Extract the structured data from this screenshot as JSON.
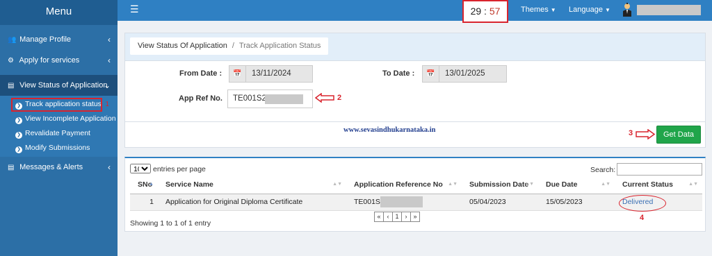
{
  "sidebar": {
    "title": "Menu",
    "items": [
      {
        "label": "Manage Profile"
      },
      {
        "label": "Apply for services"
      },
      {
        "label": "View Status of Application"
      },
      {
        "label": "Messages & Alerts"
      }
    ],
    "submenu": [
      {
        "label": "Track application status"
      },
      {
        "label": "View Incomplete Application"
      },
      {
        "label": "Revalidate Payment"
      },
      {
        "label": "Modify Submissions"
      }
    ],
    "annotation": "1"
  },
  "topbar": {
    "timer_min": "29",
    "timer_sep": ":",
    "timer_sec": "57",
    "themes": "Themes",
    "language": "Language"
  },
  "breadcrumb": {
    "root": "View Status Of Application",
    "separator": "/",
    "current": "Track Application Status"
  },
  "form": {
    "from_label": "From Date :",
    "from_value": "13/11/2024",
    "to_label": "To Date :",
    "to_value": "13/01/2025",
    "ref_label": "App Ref No.",
    "ref_value": "TE001S2",
    "ref_annotation": "2",
    "site": "www.sevasindhukarnataka.in",
    "get_button": "Get Data",
    "get_annotation": "3"
  },
  "table": {
    "length_value": "10",
    "length_label": "entries per page",
    "search_label": "Search:",
    "headers": [
      "SNo",
      "Service Name",
      "Application Reference No",
      "Submission Date",
      "Due Date",
      "Current Status"
    ],
    "rows": [
      {
        "sno": "1",
        "service": "Application for Original Diploma Certificate",
        "ref": "TE001S",
        "submission": "05/04/2023",
        "due": "15/05/2023",
        "status": "Delivered"
      }
    ],
    "status_annotation": "4",
    "info": "Showing 1 to 1 of 1 entry",
    "pager": [
      "«",
      "‹",
      "1",
      "›",
      "»"
    ]
  }
}
